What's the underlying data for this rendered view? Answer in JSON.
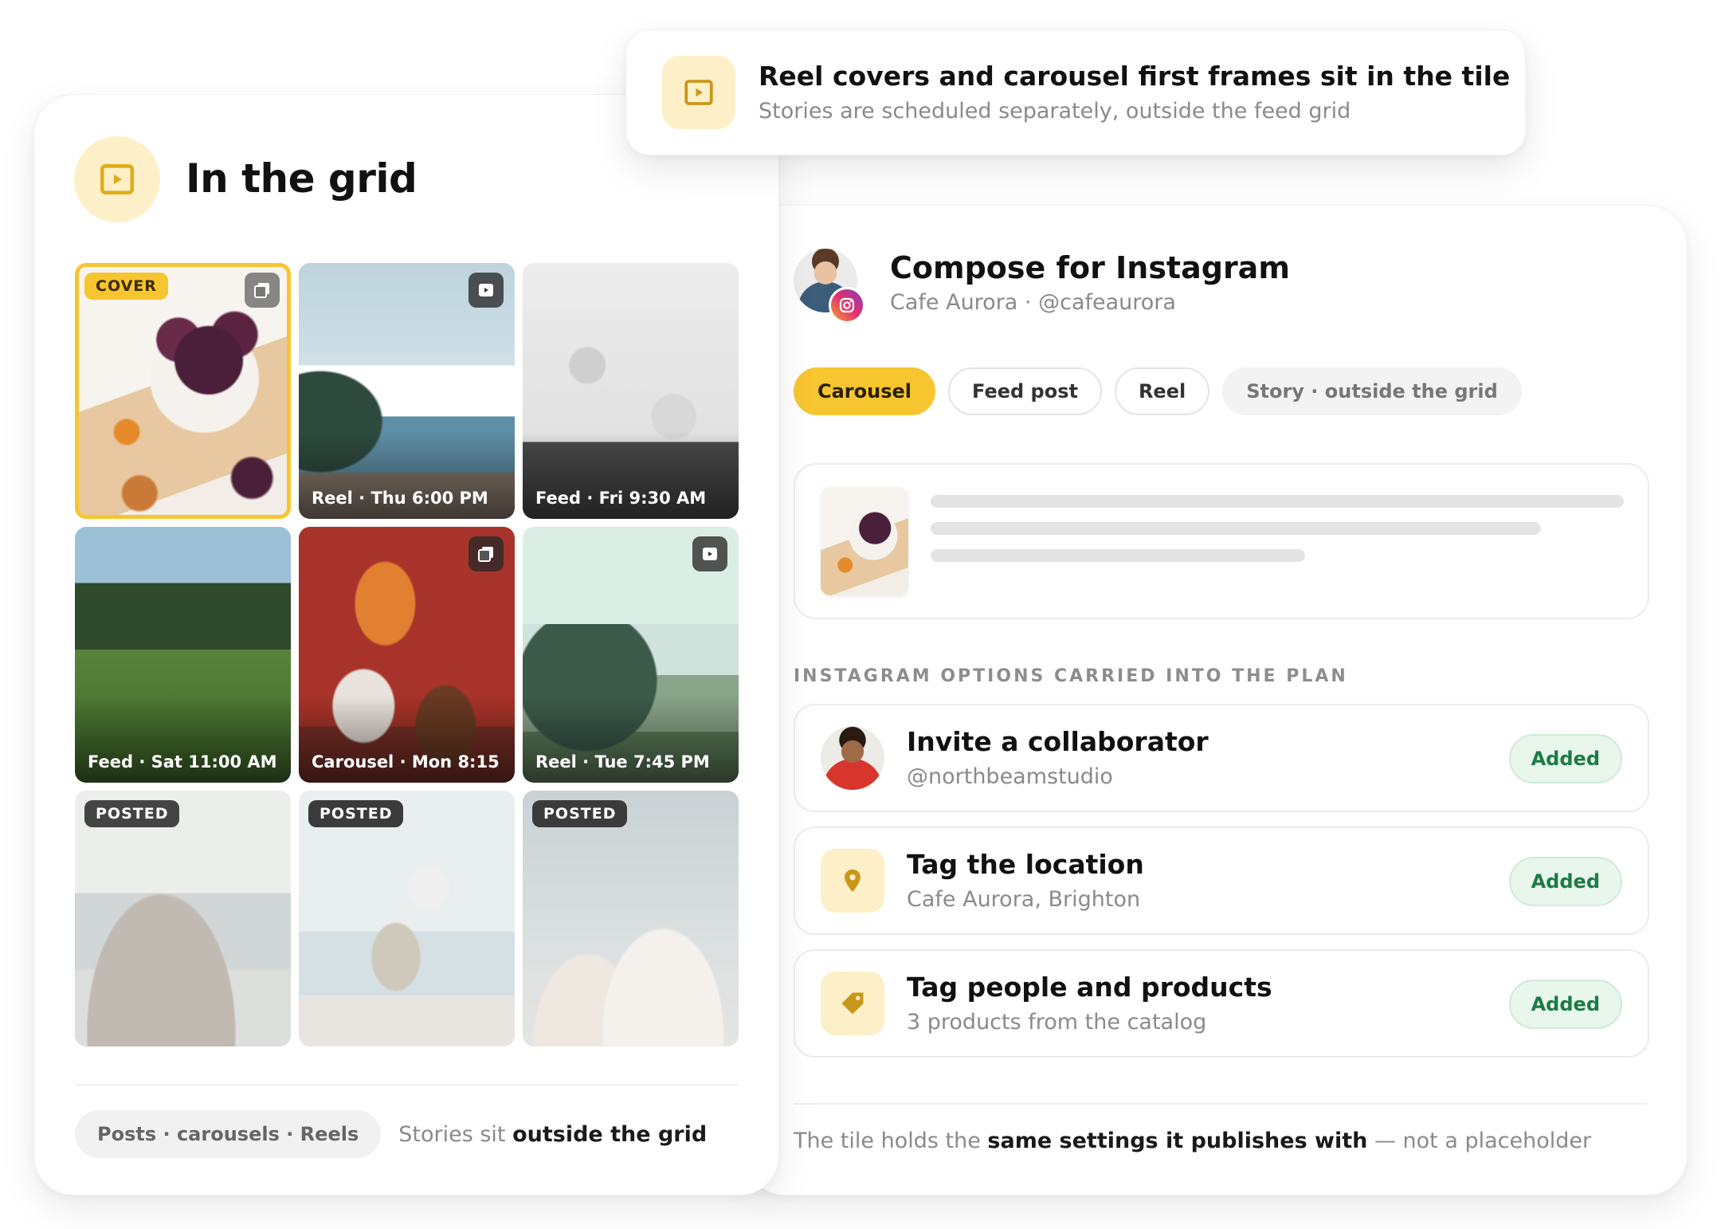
{
  "banner": {
    "title": "Reel covers and carousel first frames sit in the tile",
    "subtitle": "Stories are scheduled separately, outside the feed grid",
    "icon": "play-square-icon"
  },
  "grid": {
    "title": "In the grid",
    "icon": "play-square-icon",
    "tiles": [
      {
        "badge": "COVER",
        "caption": "",
        "type_icon": "carousel-icon",
        "state": "cover"
      },
      {
        "badge": "",
        "caption": "Reel · Thu 6:00 PM",
        "type_icon": "reel-icon",
        "state": "scheduled"
      },
      {
        "badge": "",
        "caption": "Feed · Fri 9:30 AM",
        "type_icon": "",
        "state": "scheduled"
      },
      {
        "badge": "",
        "caption": "Feed · Sat 11:00 AM",
        "type_icon": "",
        "state": "scheduled"
      },
      {
        "badge": "",
        "caption": "Carousel · Mon 8:15",
        "type_icon": "carousel-icon",
        "state": "scheduled"
      },
      {
        "badge": "",
        "caption": "Reel · Tue 7:45 PM",
        "type_icon": "reel-icon",
        "state": "scheduled"
      },
      {
        "badge": "POSTED",
        "caption": "",
        "type_icon": "",
        "state": "posted"
      },
      {
        "badge": "POSTED",
        "caption": "",
        "type_icon": "",
        "state": "posted"
      },
      {
        "badge": "POSTED",
        "caption": "",
        "type_icon": "",
        "state": "posted"
      }
    ],
    "footer": {
      "pill": "Posts · carousels · Reels",
      "text_prefix": "Stories sit ",
      "text_bold": "outside the grid"
    }
  },
  "compose": {
    "title": "Compose for Instagram",
    "account": "Cafe Aurora · @cafeaurora",
    "post_types": [
      {
        "label": "Carousel",
        "state": "active"
      },
      {
        "label": "Feed post",
        "state": "default"
      },
      {
        "label": "Reel",
        "state": "default"
      },
      {
        "label": "Story · outside the grid",
        "state": "muted"
      }
    ],
    "options_label": "INSTAGRAM OPTIONS CARRIED INTO THE PLAN",
    "options": [
      {
        "title": "Invite a collaborator",
        "subtitle": "@northbeamstudio",
        "status": "Added",
        "icon": "collaborator-avatar"
      },
      {
        "title": "Tag the location",
        "subtitle": "Cafe Aurora, Brighton",
        "status": "Added",
        "icon": "location-pin-icon"
      },
      {
        "title": "Tag people and products",
        "subtitle": "3 products from the catalog",
        "status": "Added",
        "icon": "tag-icon"
      }
    ],
    "footer": {
      "prefix": "The tile holds the ",
      "bold": "same settings it publishes with",
      "suffix": " — not a placeholder"
    }
  },
  "colors": {
    "accent": "#f6c530",
    "accent_soft": "#fdf0c8",
    "added_text": "#1e7a45",
    "added_bg": "#e8f6ec"
  }
}
